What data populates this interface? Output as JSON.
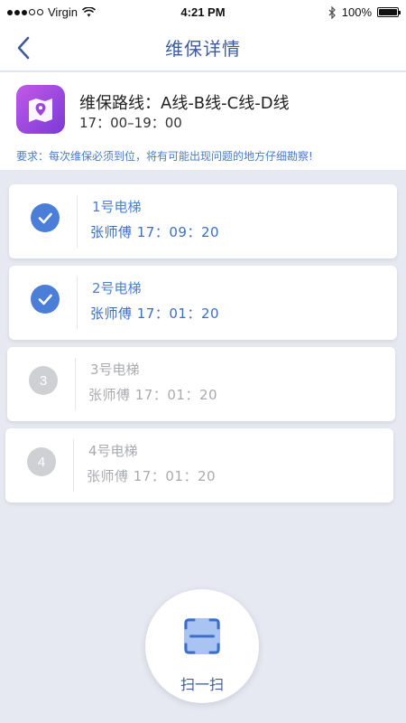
{
  "status_bar": {
    "carrier": "Virgin",
    "time": "4:21 PM",
    "battery": "100%",
    "battery_level": 1.0
  },
  "nav": {
    "title": "维保详情"
  },
  "route": {
    "title": "维保路线：A线-B线-C线-D线",
    "time": "17：00–19：00",
    "note": "要求：每次维保必须到位，将有可能出现问题的地方仔细勘察!"
  },
  "elevators": [
    {
      "name": "1号电梯",
      "detail": "张师傅  17：09：20",
      "state": "done",
      "index": ""
    },
    {
      "name": "2号电梯",
      "detail": "张师傅  17：01：20",
      "state": "done",
      "index": ""
    },
    {
      "name": "3号电梯",
      "detail": "张师傅  17：01：20",
      "state": "pending",
      "index": "3"
    },
    {
      "name": "4号电梯",
      "detail": "张师傅  17：01：20",
      "state": "pending",
      "index": "4"
    }
  ],
  "scan": {
    "label": "扫一扫"
  },
  "colors": {
    "accent": "#4a7ed9",
    "title": "#3e5c9c",
    "background": "#e6e9f1"
  }
}
